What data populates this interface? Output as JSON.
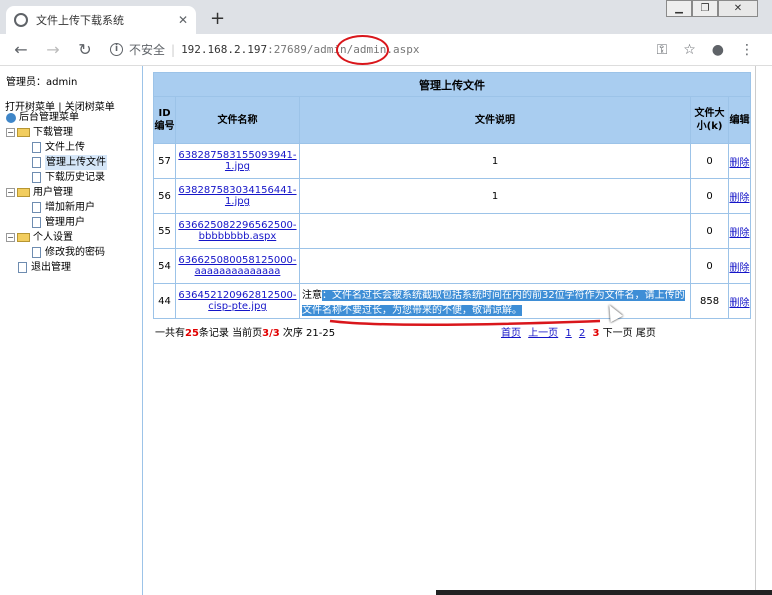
{
  "browser": {
    "tab_title": "文件上传下载系统",
    "not_secure": "不安全",
    "url_host": "192.168.2.197",
    "url_rest": ":27689/admin/admin.aspx"
  },
  "sidebar": {
    "admin_label": "管理员：admin",
    "open_tree": "打开树菜单",
    "divider": "|",
    "close_tree": "关闭树菜单",
    "root": "后台管理菜单",
    "items": [
      {
        "label": "下载管理",
        "type": "folder"
      },
      {
        "label": "文件上传",
        "type": "page"
      },
      {
        "label": "管理上传文件",
        "type": "page",
        "selected": true
      },
      {
        "label": "下载历史记录",
        "type": "page"
      },
      {
        "label": "用户管理",
        "type": "folder"
      },
      {
        "label": "增加新用户",
        "type": "page"
      },
      {
        "label": "管理用户",
        "type": "page"
      },
      {
        "label": "个人设置",
        "type": "folder"
      },
      {
        "label": "修改我的密码",
        "type": "page"
      },
      {
        "label": "退出管理",
        "type": "page"
      }
    ]
  },
  "table": {
    "caption": "管理上传文件",
    "headers": [
      "ID编号",
      "文件名称",
      "文件说明",
      "文件大小(k)",
      "编辑"
    ],
    "rows": [
      {
        "id": "57",
        "name": "638287583155093941-1.jpg",
        "desc": "1",
        "size": "0",
        "action": "删除"
      },
      {
        "id": "56",
        "name": "638287583034156441-1.jpg",
        "desc": "1",
        "size": "0",
        "action": "删除"
      },
      {
        "id": "55",
        "name": "636625082296562500-bbbbbbbb.aspx",
        "desc": "",
        "size": "0",
        "action": "删除"
      },
      {
        "id": "54",
        "name": "636625080058125000-aaaaaaaaaaaaaa",
        "desc": "",
        "size": "0",
        "action": "删除"
      },
      {
        "id": "44",
        "name": "636452120962812500-cisp-pte.jpg",
        "desc_prefix": "注意",
        "desc_highlight": "：文件名过长会被系统截取包括系统时间在内的前32位字符作为文件名，请上传的文件名称不要过长，为您带来的不便，敬请谅解。",
        "size": "858",
        "action": "删除"
      }
    ]
  },
  "footer": {
    "total_prefix": "一共有",
    "total": "25",
    "total_suffix": "条记录 当前页",
    "page": "3/3",
    "order": "次序 21-25"
  },
  "pager": {
    "first": "首页",
    "prev": "上一页",
    "p1": "1",
    "p2": "2",
    "current": "3",
    "next": "下一页",
    "last": "尾页"
  },
  "colors": {
    "header_bg": "#a9cdf0",
    "border": "#9cc3e8",
    "link": "#1515c8",
    "highlight": "#3e8ed6",
    "annotation": "#d9161b"
  }
}
